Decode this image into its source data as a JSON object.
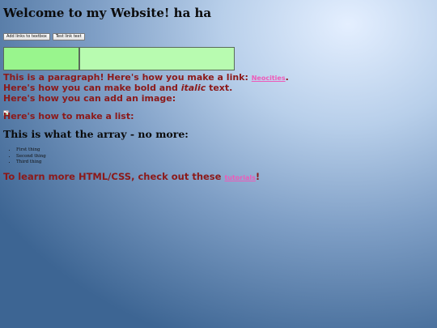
{
  "page": {
    "heading": "Welcome to my Website! ha ha"
  },
  "toolbar": {
    "add_links_label": "Add links to textbox",
    "test_link_label": "Test link text"
  },
  "textboxes": {
    "left_value": "",
    "right_value": ""
  },
  "content": {
    "paragraph_prefix": "This is a paragraph! Here's how you make a link: ",
    "paragraph_link": "Neocities",
    "paragraph_suffix": ".",
    "bold_prefix": "Here's how you can make bold and ",
    "bold_italic": "italic",
    "bold_suffix": " text.",
    "image_line": "Here's how you can add an image:",
    "list_line": "Here's how to make a list:",
    "array_heading": "This is what the array - no more:",
    "list_items": [
      "First thing",
      "Second thing",
      "Third thing"
    ],
    "learn_prefix": "To learn more HTML/CSS, check out these ",
    "learn_link": "tutorials",
    "learn_suffix": "!"
  },
  "colors": {
    "text_red": "#8c1919",
    "link_pink": "#ee5ab9",
    "textbox_left": "#99f58d",
    "textbox_right": "#b8fbb0"
  },
  "icons": {
    "image_placeholder": "broken-image-icon"
  }
}
